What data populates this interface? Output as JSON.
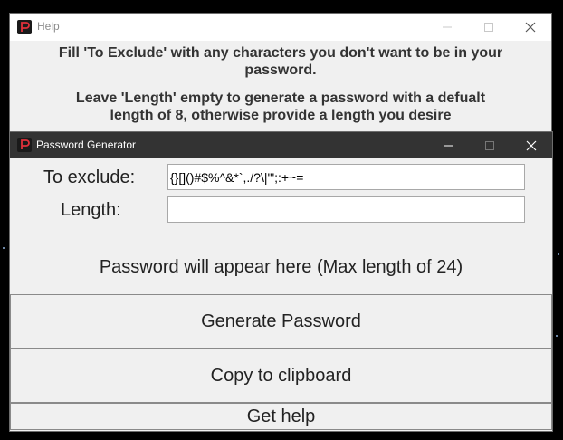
{
  "help_window": {
    "title": "Help",
    "line1": "Fill 'To Exclude' with any characters you don't want to be in your",
    "line2": "password.",
    "line3": "Leave 'Length' empty to generate a password with a defualt",
    "line4": "length of 8, otherwise provide a length you desire",
    "icons": {
      "app": "app-p-icon",
      "minimize": "minimize-icon",
      "maximize": "maximize-icon",
      "close": "close-icon"
    }
  },
  "main_window": {
    "title": "Password Generator",
    "exclude_label": "To exclude:",
    "exclude_value": "{}[]()#$%^&*`,./?\\|'\";:+~=",
    "length_label": "Length:",
    "length_value": "",
    "output_text": "Password will appear here (Max length of 24)",
    "generate_label": "Generate Password",
    "copy_label": "Copy to clipboard",
    "help_label": "Get help",
    "icons": {
      "app": "app-p-icon",
      "minimize": "minimize-icon",
      "maximize": "maximize-icon",
      "close": "close-icon"
    }
  },
  "colors": {
    "title_bar_active": "#333333",
    "title_bar_inactive": "#ffffff",
    "window_bg": "#f0f0f0",
    "icon_accent": "#e0303a",
    "desktop": "#000000"
  }
}
